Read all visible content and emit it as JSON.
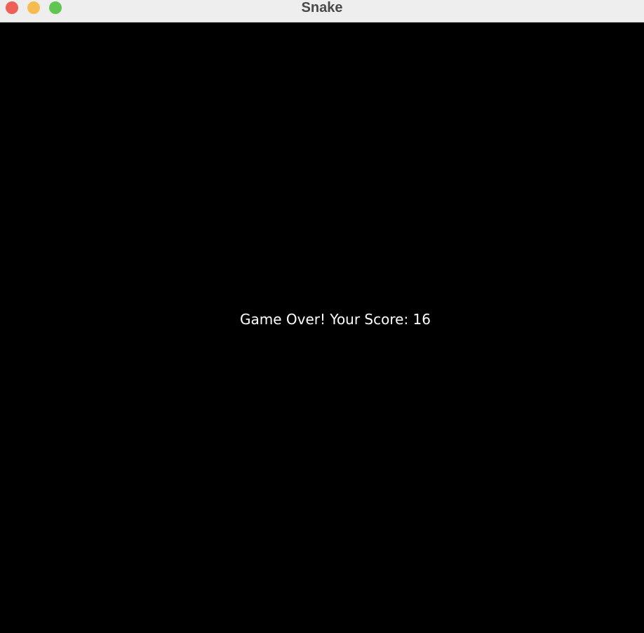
{
  "window": {
    "title": "Snake",
    "controls": {
      "close_color": "#ee5f57",
      "minimize_color": "#f5bd4f",
      "zoom_color": "#61c554"
    }
  },
  "game": {
    "background_color": "#000000",
    "text_color": "#ffffff",
    "message": "Game Over! Your Score: 16"
  }
}
